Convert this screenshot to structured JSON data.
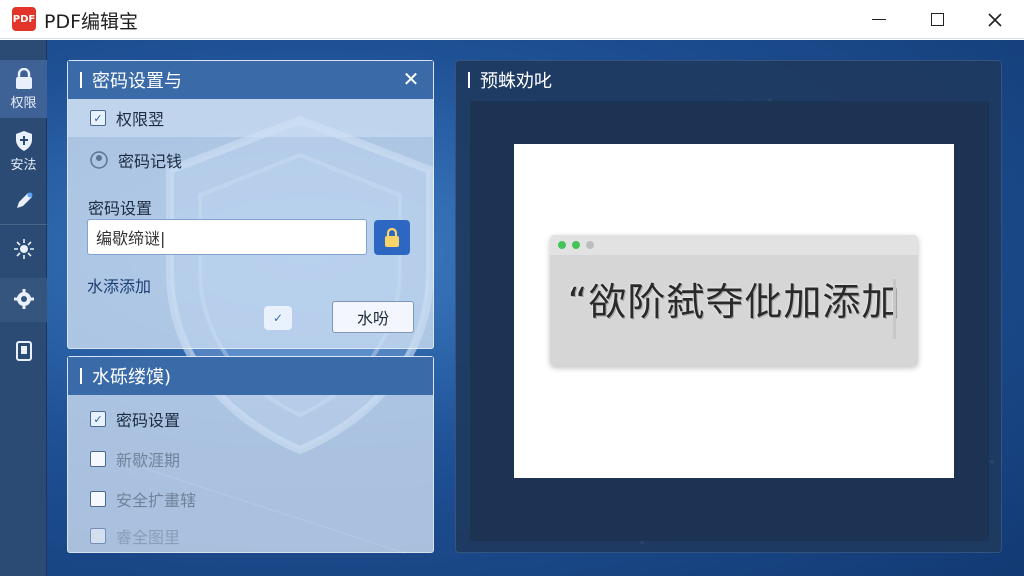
{
  "window": {
    "app_logo_text": "PDF",
    "title": "PDF编辑宝",
    "controls": [
      "minimize",
      "maximize",
      "close"
    ]
  },
  "sidebar": {
    "items": [
      {
        "label": "权限",
        "icon": "lock-icon",
        "active": true
      },
      {
        "label": "安法",
        "icon": "shield-icon",
        "active": false
      },
      {
        "label": "",
        "icon": "pen-icon",
        "active": false
      },
      {
        "label": "",
        "icon": "sun-gear-icon",
        "active": false
      },
      {
        "label": "",
        "icon": "gear-icon",
        "active": false
      },
      {
        "label": "",
        "icon": "document-icon",
        "active": false
      }
    ]
  },
  "password_panel": {
    "title": "密码设置与",
    "close_label": "✕",
    "options": [
      {
        "label": "权限翌",
        "checked": true
      },
      {
        "label": "密码记钱",
        "checked": false
      }
    ],
    "password_label": "密码设置",
    "password_value": "编歇缔谜|",
    "add_link": "水添添加",
    "watermark_button": "水吩",
    "toggle_check": "✓"
  },
  "watermark_panel": {
    "title": "水砾缕馍)",
    "options": [
      {
        "label": "密码设置",
        "checked": true
      },
      {
        "label": "新歇涯期",
        "checked": false
      },
      {
        "label": "安全扩畫辖",
        "checked": false
      },
      {
        "label": "睿全图里",
        "checked": false
      }
    ]
  },
  "preview": {
    "title": "预蛛劝叱",
    "watermark_text": "“欲阶弑夺仳加添加",
    "window_dot_colors": [
      "#46c35a",
      "#46c35a",
      "#bdbdbd"
    ]
  },
  "colors": {
    "accent": "#3a6aa8",
    "background_deep": "#123a73",
    "sidebar": "#2b4a74",
    "lock_button": "#2e67c2"
  }
}
